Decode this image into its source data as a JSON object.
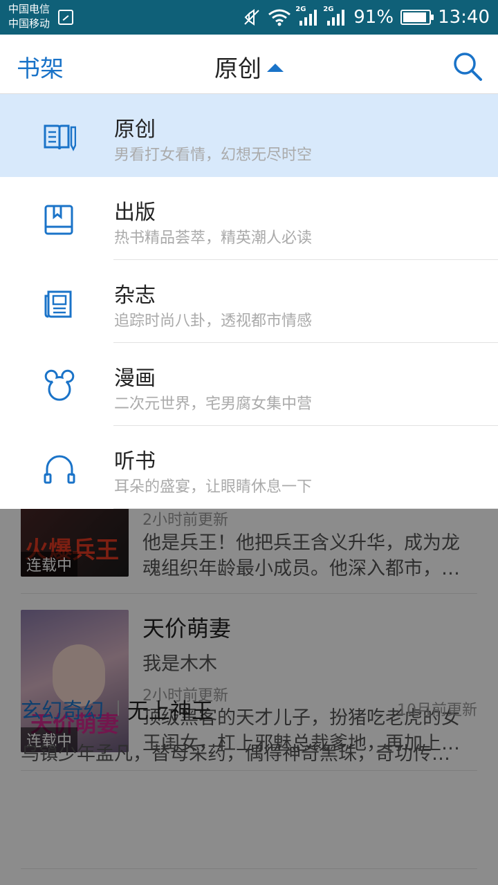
{
  "status_bar": {
    "carrier1": "中国电信",
    "carrier2": "中国移动",
    "net1": "2G",
    "net2": "2G",
    "battery": "91%",
    "battery_level": 0.91,
    "time": "13:40"
  },
  "header": {
    "left_label": "书架",
    "title": "原创",
    "accent": "#1a73c8"
  },
  "dropdown": {
    "items": [
      {
        "title": "原创",
        "subtitle": "男看打女看情，幻想无尽时空",
        "icon": "book-edit-icon",
        "selected": true
      },
      {
        "title": "出版",
        "subtitle": "热书精品荟萃，精英潮人必读",
        "icon": "book-icon",
        "selected": false
      },
      {
        "title": "杂志",
        "subtitle": "追踪时尚八卦，透视都市情感",
        "icon": "magazine-icon",
        "selected": false
      },
      {
        "title": "漫画",
        "subtitle": "二次元世界，宅男腐女集中营",
        "icon": "mickey-icon",
        "selected": false
      },
      {
        "title": "听书",
        "subtitle": "耳朵的盛宴，让眼睛休息一下",
        "icon": "headphones-icon",
        "selected": false
      }
    ]
  },
  "books": [
    {
      "cover_text": "火爆兵王",
      "status": "连载中",
      "time": "2小时前更新",
      "desc": "他是兵王！他把兵王含义升华，成为龙魂组织年龄最小成员。他深入都市，…"
    },
    {
      "title": "天价萌妻",
      "author": "我是木木",
      "cover_text": "天价萌妻",
      "status": "连载中",
      "time": "2小时前更新",
      "desc": "顶级黑客的天才儿子，扮猪吃老虎的女王闺女，杠上邪魅总裁爹地，再加上…"
    }
  ],
  "list_item": {
    "category": "玄幻奇幻",
    "title": "无上神王",
    "time": "10月前更新",
    "desc": "乌镇少年孟凡，替母采药，偶得神奇黑珠，奇功传…"
  }
}
